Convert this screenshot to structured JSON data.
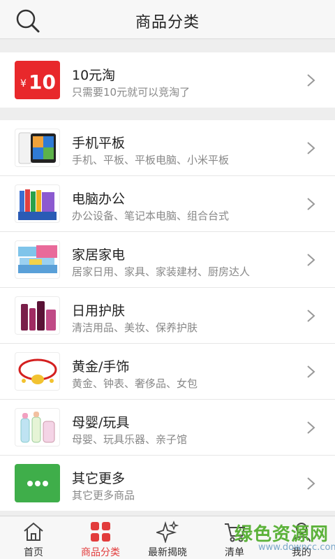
{
  "header": {
    "title": "商品分类",
    "search_icon": "search-icon"
  },
  "promo": {
    "badge": "¥10",
    "name": "10元淘",
    "desc": "只需要10元就可以竞淘了"
  },
  "categories": [
    {
      "name": "手机平板",
      "desc": "手机、平板、平板电脑、小米平板"
    },
    {
      "name": "电脑办公",
      "desc": "办公设备、笔记本电脑、组合台式"
    },
    {
      "name": "家居家电",
      "desc": "居家日用、家具、家装建材、厨房达人"
    },
    {
      "name": "日用护肤",
      "desc": "清洁用品、美妆、保养护肤"
    },
    {
      "name": "黄金/手饰",
      "desc": "黄金、钟表、奢侈品、女包"
    },
    {
      "name": "母婴/玩具",
      "desc": "母婴、玩具乐器、亲子馆"
    },
    {
      "name": "其它更多",
      "desc": "其它更多商品"
    }
  ],
  "tabs": [
    {
      "label": "首页",
      "icon": "home-icon"
    },
    {
      "label": "商品分类",
      "icon": "grid-icon",
      "active": true
    },
    {
      "label": "最新揭晓",
      "icon": "sparkle-icon"
    },
    {
      "label": "清单",
      "icon": "cart-icon"
    },
    {
      "label": "我的",
      "icon": "user-icon"
    }
  ],
  "watermark": {
    "text": "绿色资源网",
    "url": "www.downcc.com"
  },
  "colors": {
    "accent": "#e23c3c",
    "more_green": "#3fae4a",
    "watermark_green": "#5cb23a"
  }
}
